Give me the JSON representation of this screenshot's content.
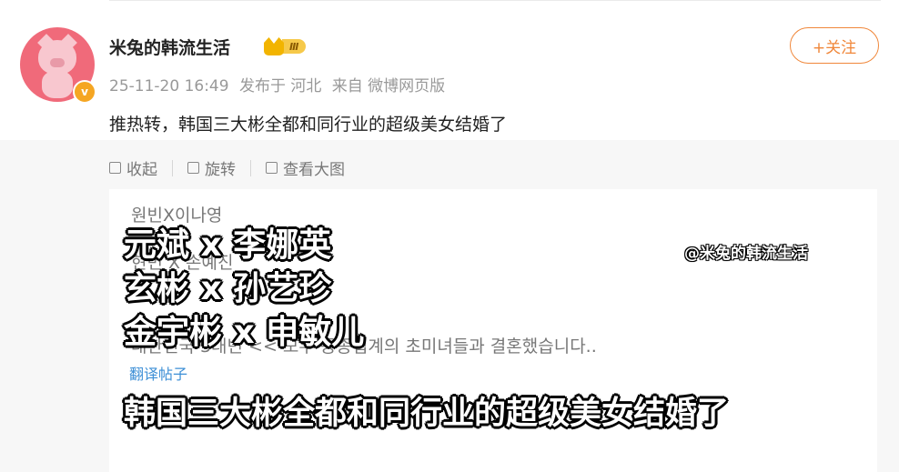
{
  "post": {
    "username": "米兔的韩流生活",
    "level_badge": "Ⅲ",
    "verified_mark": "v",
    "timestamp": "25-11-20 16:49",
    "published_at": "发布于 河北",
    "source": "来自 微博网页版",
    "follow_label": "+关注",
    "text": "推热转，韩国三大彬全都和同行业的超级美女结婚了"
  },
  "toolbar": {
    "collapse_label": "收起",
    "rotate_label": "旋转",
    "view_large_label": "查看大图"
  },
  "image": {
    "bg_line1": "원빈X이나영",
    "bg_line2": "현빈 X 손예진",
    "bg_line3": "대한민국 3대빈 << 모두 동종업계의 초미녀들과 결혼했습니다..",
    "translate_link": "翻译帖子",
    "overlay_line1": "元斌 x 李娜英",
    "overlay_line2": "玄彬 x 孙艺珍",
    "overlay_line3": "金宇彬 x 申敏儿",
    "watermark": "@米兔的韩流生活",
    "headline": "韩国三大彬全都和同行业的超级美女结婚了"
  },
  "colors": {
    "accent": "#f0873a",
    "link": "#3d8fd6",
    "meta": "#999999"
  }
}
